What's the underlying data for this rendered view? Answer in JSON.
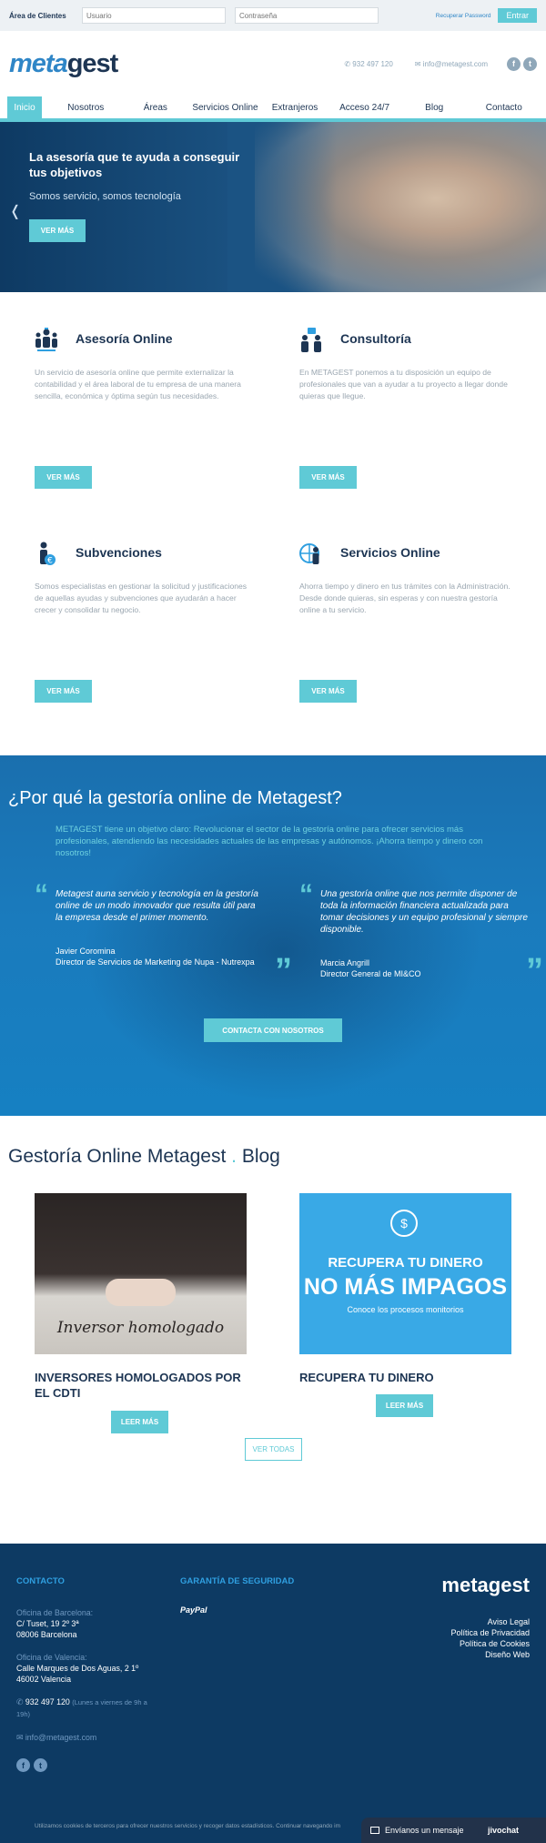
{
  "topbar": {
    "client_area_label": "Área de Clientes",
    "user_placeholder": "Usuario",
    "password_placeholder": "Contraseña",
    "recover_password": "Recuperar Password",
    "enter_button": "Entrar"
  },
  "header": {
    "logo_meta": "meta",
    "logo_gest": "gest",
    "phone": "932 497 120",
    "email": "info@metagest.com",
    "social": [
      "f",
      "t"
    ]
  },
  "nav": {
    "items": [
      "Inicio",
      "Nosotros",
      "Áreas",
      "Servicios Online",
      "Extranjeros",
      "Acceso 24/7",
      "Blog",
      "Contacto"
    ],
    "active_index": 0
  },
  "hero": {
    "title": "La asesoría que te ayuda a conseguir tus objetivos",
    "subtitle": "Somos servicio, somos tecnología",
    "button": "VER MÁS",
    "prev_arrow": "❬"
  },
  "services": [
    {
      "name": "Asesoría Online",
      "description": "Un servicio de asesoría online que permite externalizar la contabilidad y el área laboral de tu empresa de una manera sencilla, económica y óptima según tus necesidades.",
      "button": "VER MÁS",
      "icon": "team-icon"
    },
    {
      "name": "Consultoría",
      "description": "En METAGEST ponemos a tu disposición un equipo de profesionales que van a ayudar a tu proyecto a llegar donde quieras que llegue.",
      "button": "VER MÁS",
      "icon": "consulting-icon"
    },
    {
      "name": "Subvenciones",
      "description": "Somos especialistas en gestionar la solicitud y justificaciones de aquellas ayudas y subvenciones que ayudarán a hacer crecer y consolidar tu negocio.",
      "button": "VER MÁS",
      "icon": "euro-person-icon"
    },
    {
      "name": "Servicios Online",
      "description": "Ahorra tiempo y dinero en tus trámites con la Administración. Desde donde quieras, sin esperas y con nuestra gestoría online a tu servicio.",
      "button": "VER MÁS",
      "icon": "globe-person-icon"
    }
  ],
  "why": {
    "title": "¿Por qué la gestoría online de Metagest?",
    "intro": "METAGEST tiene un objetivo claro: Revolucionar el sector de la gestoría online para ofrecer servicios más profesionales, atendiendo las necesidades actuales de las empresas y autónomos. ¡Ahorra tiempo y dinero con nosotros!",
    "quotes": [
      {
        "text": "Metagest auna servicio y tecnología en la gestoría online de un modo innovador que resulta útil para la empresa desde el primer momento.",
        "author": "Javier Coromina",
        "role": "Director de Servicios de Marketing de Nupa - Nutrexpa"
      },
      {
        "text": "Una gestoría online que nos permite disponer de toda la información financiera actualizada para tomar decisiones y un equipo profesional y siempre disponible.",
        "author": "Marcia Angrill",
        "role": "Director General de MI&CO"
      }
    ],
    "open_quote": "“",
    "close_quote": "”",
    "button": "CONTACTA CON NOSOTROS"
  },
  "blog": {
    "title_main": "Gestoría Online Metagest",
    "title_dot": ".",
    "title_end": "Blog",
    "posts": [
      {
        "image_caption": "Inversor homologado",
        "title": "INVERSORES HOMOLOGADOS POR EL CDTI",
        "button": "LEER MÁS"
      },
      {
        "image_line1": "RECUPERA TU DINERO",
        "image_line2": "NO MÁS IMPAGOS",
        "image_line3": "Conoce los procesos monitorios",
        "image_symbol": "$",
        "title": "RECUPERA TU DINERO",
        "button": "LEER MÁS"
      }
    ],
    "view_all": "VER TODAS"
  },
  "footer": {
    "contact_heading": "CONTACTO",
    "security_heading": "GARANTÍA DE SEGURIDAD",
    "paypal": "PayPal",
    "barcelona_label": "Oficina de Barcelona:",
    "barcelona_line1": "C/ Tuset, 19 2º 3ª",
    "barcelona_line2": "08006 Barcelona",
    "valencia_label": "Oficina de Valencia:",
    "valencia_line1": "Calle Marques de Dos Aguas, 2 1º",
    "valencia_line2": "46002 Valencia",
    "phone": "932 497 120",
    "hours": "(Lunes a viernes de 9h a 19h)",
    "email": "info@metagest.com",
    "logo": "metagest",
    "links": [
      "Aviso Legal",
      "Política de Privacidad",
      "Política de Cookies",
      "Diseño Web"
    ],
    "cookie_notice": "Utilizamos cookies de terceros para ofrecer nuestros servicios y recoger datos estadísticos. Continuar navegando im"
  },
  "chat": {
    "label": "Envíanos un mensaje",
    "brand": "jivochat"
  },
  "colors": {
    "navy": "#1d3553",
    "accent": "#5fcad6",
    "blue": "#2f86c7",
    "footer": "#0d3a63"
  }
}
